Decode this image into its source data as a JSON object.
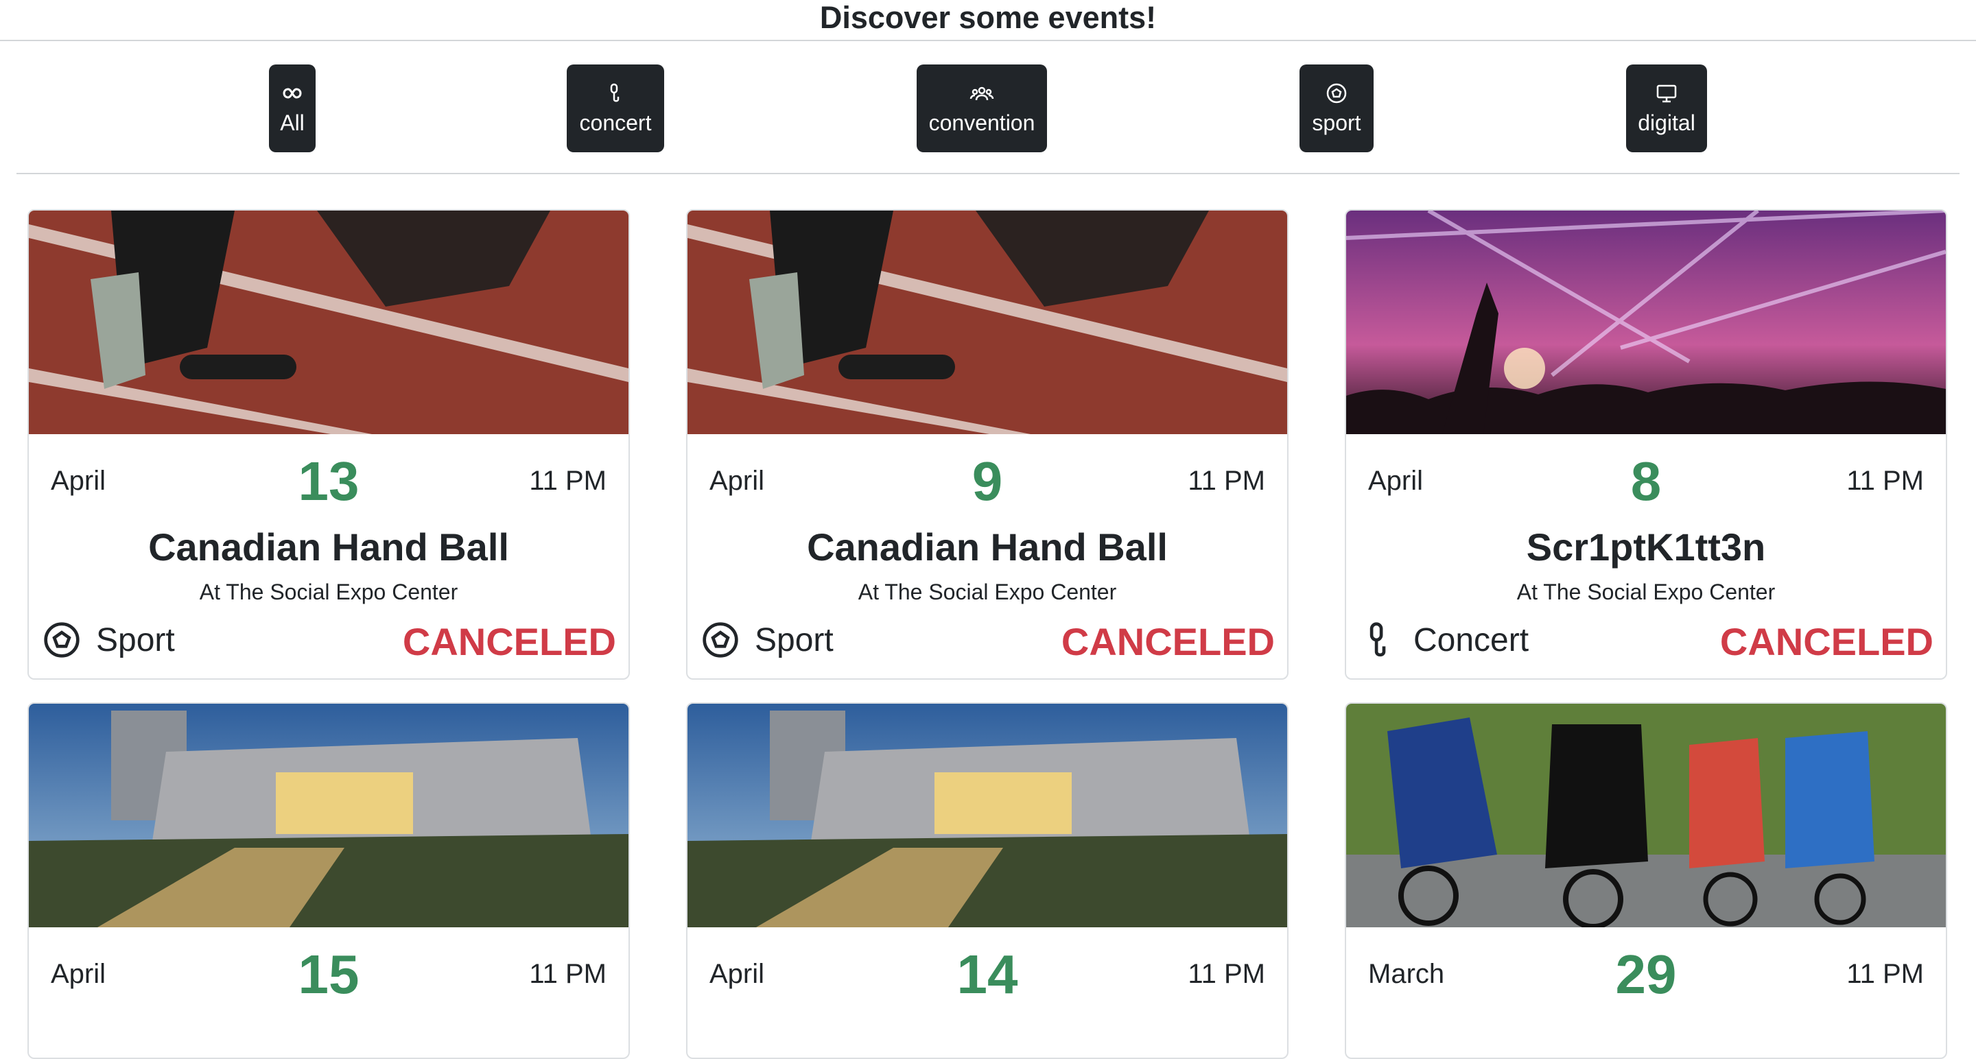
{
  "header": {
    "title": "Discover some events!"
  },
  "filters": [
    {
      "label": "All",
      "icon": "infinity-icon"
    },
    {
      "label": "concert",
      "icon": "microphone-icon"
    },
    {
      "label": "convention",
      "icon": "people-icon"
    },
    {
      "label": "sport",
      "icon": "soccer-ball-icon"
    },
    {
      "label": "digital",
      "icon": "monitor-icon"
    }
  ],
  "events": [
    {
      "month": "April",
      "day": "13",
      "time": "11 PM",
      "name": "Canadian Hand Ball",
      "venue": "At The Social Expo Center",
      "category": "Sport",
      "category_icon": "soccer-ball-icon",
      "status": "CANCELED",
      "image": "running-track"
    },
    {
      "month": "April",
      "day": "9",
      "time": "11 PM",
      "name": "Canadian Hand Ball",
      "venue": "At The Social Expo Center",
      "category": "Sport",
      "category_icon": "soccer-ball-icon",
      "status": "CANCELED",
      "image": "running-track"
    },
    {
      "month": "April",
      "day": "8",
      "time": "11 PM",
      "name": "Scr1ptK1tt3n",
      "venue": "At The Social Expo Center",
      "category": "Concert",
      "category_icon": "microphone-icon",
      "status": "CANCELED",
      "image": "concert-crowd"
    },
    {
      "month": "April",
      "day": "15",
      "time": "11 PM",
      "image": "arena-building"
    },
    {
      "month": "April",
      "day": "14",
      "time": "11 PM",
      "image": "arena-building"
    },
    {
      "month": "March",
      "day": "29",
      "time": "11 PM",
      "image": "cycling-race"
    }
  ],
  "colors": {
    "button_bg": "#212529",
    "day_green": "#3a8d5c",
    "canceled_red": "#d03b47"
  }
}
